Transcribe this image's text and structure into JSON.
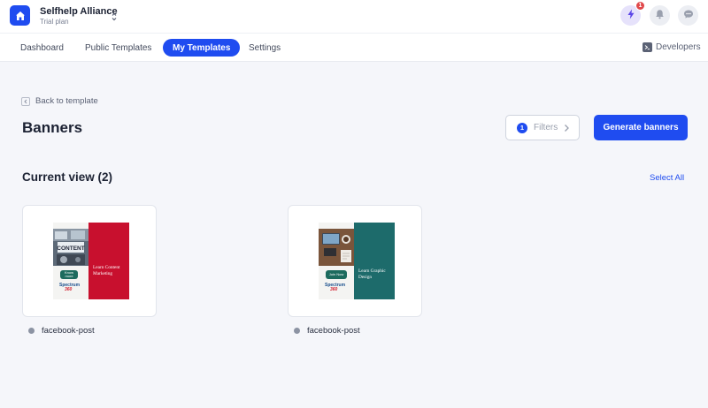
{
  "header": {
    "org_name": "Selfhelp Alliance",
    "plan": "Trial plan",
    "notification_count": "1",
    "icons": {
      "logo": "home-icon",
      "switcher": "chevron-up-down-icon",
      "bolt": "lightning-icon",
      "bell": "bell-icon",
      "chat": "chat-icon"
    }
  },
  "nav": {
    "tabs": [
      {
        "label": "Dashboard"
      },
      {
        "label": "Public Templates"
      },
      {
        "label": "My Templates"
      },
      {
        "label": "Settings"
      }
    ],
    "active_tab": "My Templates",
    "developers_label": "Developers"
  },
  "page": {
    "back_label": "Back to template",
    "title": "Banners",
    "filters_count": "1",
    "filters_label": "Filters",
    "generate_label": "Generate banners",
    "section_title": "Current view (2)",
    "select_all_label": "Select All"
  },
  "banners": [
    {
      "name": "facebook-post",
      "accent_color": "#c8102e",
      "cta_color": "#1d6b5e",
      "photo_caption": "CONTENT",
      "cta": "Know more",
      "headline": "Learn Content Marketing",
      "brand_line1": "Spectrum",
      "brand_line2": "360"
    },
    {
      "name": "facebook-post",
      "accent_color": "#1d6b6b",
      "cta_color": "#1d6b5e",
      "photo_caption": "",
      "cta": "Join Now",
      "headline": "Learn Graphic Design",
      "brand_line1": "Spectrum",
      "brand_line2": "360"
    }
  ],
  "colors": {
    "primary": "#1f4cf0",
    "background": "#f5f6fa",
    "badge": "#e0484a"
  }
}
